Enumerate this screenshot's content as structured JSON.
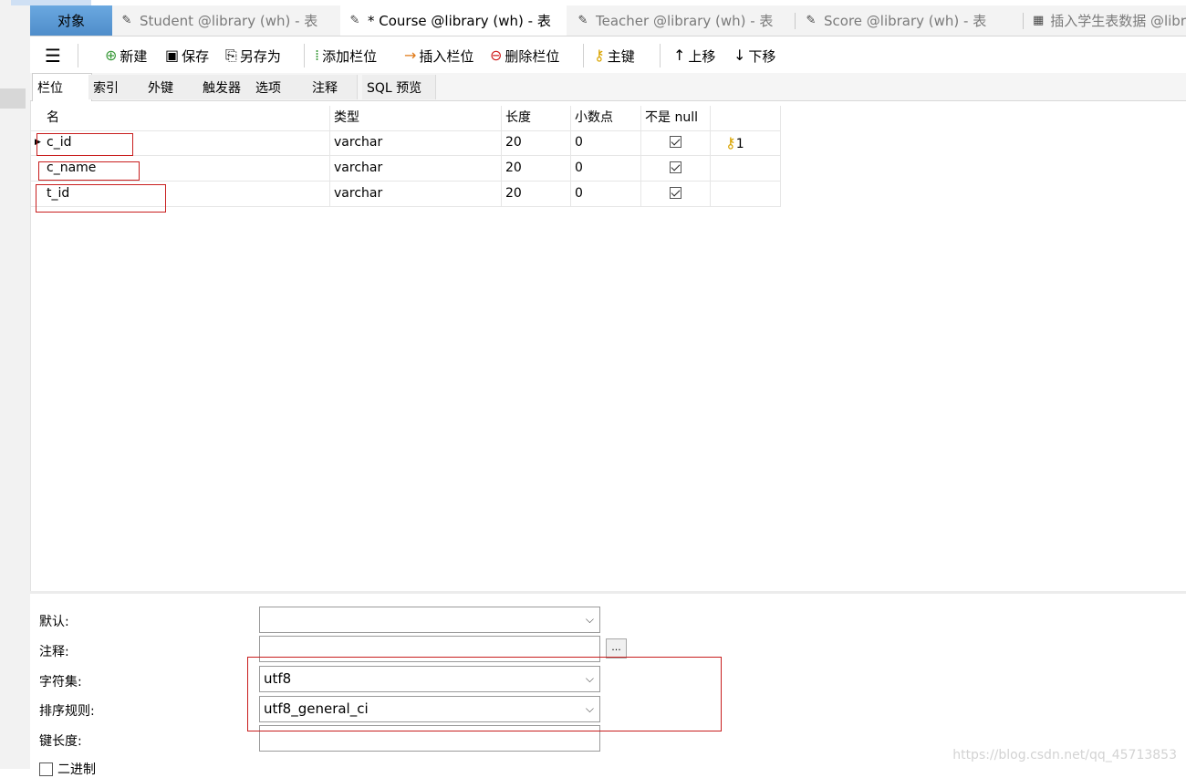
{
  "tabs": [
    {
      "label": "对象",
      "icon": "object-icon"
    },
    {
      "label": "Student @library (wh) - 表",
      "icon": "table-design-icon"
    },
    {
      "label": "* Course @library (wh) - 表",
      "icon": "table-design-icon"
    },
    {
      "label": "Teacher @library (wh) - 表",
      "icon": "table-design-icon"
    },
    {
      "label": "Score @library (wh) - 表",
      "icon": "table-design-icon"
    },
    {
      "label": "插入学生表数据 @libr",
      "icon": "table-grid-icon"
    }
  ],
  "toolbar": {
    "new": "新建",
    "save": "保存",
    "save_as": "另存为",
    "add_column": "添加栏位",
    "insert_column": "插入栏位",
    "delete_column": "删除栏位",
    "primary_key": "主键",
    "move_up": "上移",
    "move_down": "下移"
  },
  "subtabs": [
    "栏位",
    "索引",
    "外键",
    "触发器",
    "选项",
    "注释",
    "SQL 预览"
  ],
  "grid": {
    "headers": [
      "名",
      "类型",
      "长度",
      "小数点",
      "不是 null",
      ""
    ],
    "rows": [
      {
        "name": "c_id",
        "type": "varchar",
        "length": "20",
        "decimals": "0",
        "not_null": true,
        "key": "1"
      },
      {
        "name": "c_name",
        "type": "varchar",
        "length": "20",
        "decimals": "0",
        "not_null": true,
        "key": ""
      },
      {
        "name": "t_id",
        "type": "varchar",
        "length": "20",
        "decimals": "0",
        "not_null": true,
        "key": ""
      }
    ]
  },
  "properties": {
    "default_label": "默认:",
    "default_value": "",
    "comment_label": "注释:",
    "comment_value": "",
    "comment_button": "...",
    "charset_label": "字符集:",
    "charset_value": "utf8",
    "collation_label": "排序规则:",
    "collation_value": "utf8_general_ci",
    "key_length_label": "键长度:",
    "key_length_value": "",
    "binary_label": "二进制"
  },
  "watermark": "https://blog.csdn.net/qq_45713853"
}
